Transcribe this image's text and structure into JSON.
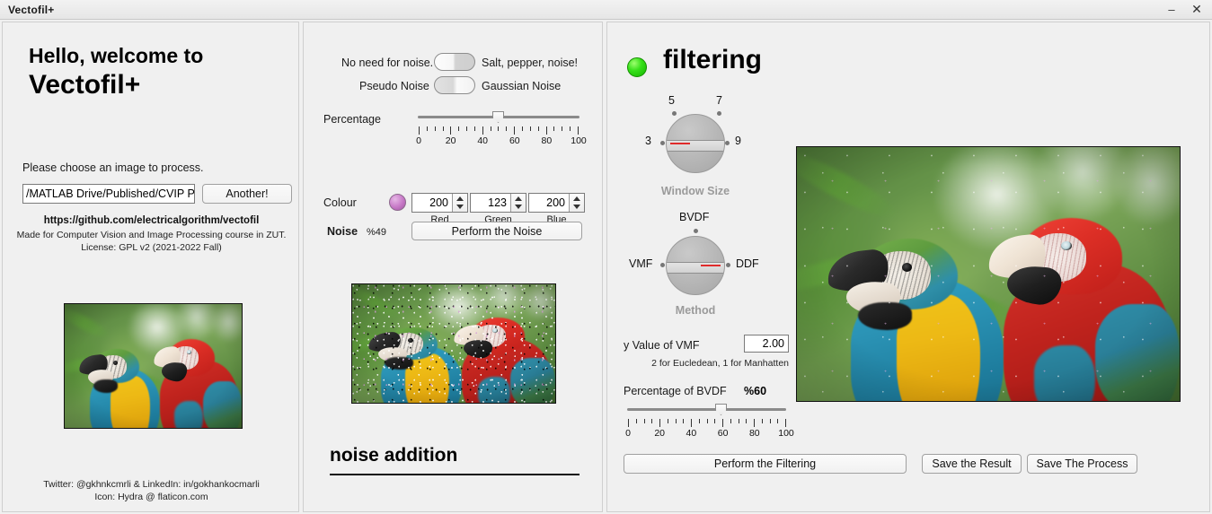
{
  "window": {
    "title": "Vectofil+",
    "minimize_label": "–",
    "close_label": "✕"
  },
  "left_panel": {
    "welcome_line1": "Hello, welcome to",
    "welcome_line2": "Vectofil+",
    "choose_label": "Please choose an image to process.",
    "path_value": "/MATLAB Drive/Published/CVIP Pr",
    "another_button": "Another!",
    "github_link": "https://github.com/electricalgorithm/vectofil",
    "credit_line1": "Made for Computer Vision and Image Processing course in ZUT.",
    "credit_line2": "License: GPL v2 (2021-2022 Fall)",
    "social_line1": "Twitter: @gkhnkcmrli & LinkedIn: in/gokhankocmarli",
    "social_line2": "Icon: Hydra @ flaticon.com",
    "original_image_alt": "two macaws original photo"
  },
  "middle_panel": {
    "toggle_noise_type": {
      "left_label": "No need for noise.",
      "right_label": "Salt, pepper, noise!",
      "state": "left"
    },
    "toggle_noise_model": {
      "left_label": "Pseudo Noise",
      "right_label": "Gaussian Noise",
      "state": "right"
    },
    "percentage": {
      "label": "Percentage",
      "value": 49,
      "min": 0,
      "max": 100,
      "tick_labels": [
        "0",
        "20",
        "40",
        "60",
        "80",
        "100"
      ]
    },
    "colour": {
      "label": "Colour",
      "swatch_hex": "#c87bc8",
      "red": {
        "value": "200",
        "label": "Red"
      },
      "green": {
        "value": "123",
        "label": "Green"
      },
      "blue": {
        "value": "200",
        "label": "Blue"
      }
    },
    "noise": {
      "label": "Noise",
      "percent_text": "%49",
      "button": "Perform the Noise"
    },
    "section_title": "noise addition",
    "noisy_image_alt": "two macaws with salt and pepper noise"
  },
  "right_panel": {
    "status_led_hex": "#37e01a",
    "title": "filtering",
    "window_size_knob": {
      "caption": "Window Size",
      "options": [
        "3",
        "5",
        "7",
        "9"
      ],
      "selected": "3"
    },
    "method_knob": {
      "caption": "Method",
      "options": [
        "VMF",
        "BVDF",
        "DDF"
      ],
      "selected": "DDF"
    },
    "y_value": {
      "label": "y Value of VMF",
      "value": "2.00",
      "hint": "2 for Eucledean, 1 for Manhatten"
    },
    "bvdf_percentage": {
      "label": "Percentage of BVDF",
      "percent_text": "%60",
      "value": 60,
      "min": 0,
      "max": 100,
      "tick_labels": [
        "0",
        "20",
        "40",
        "60",
        "80",
        "100"
      ]
    },
    "buttons": {
      "perform": "Perform the Filtering",
      "save_result": "Save the Result",
      "save_process": "Save The Process"
    },
    "filtered_image_alt": "two macaws filtered result"
  }
}
